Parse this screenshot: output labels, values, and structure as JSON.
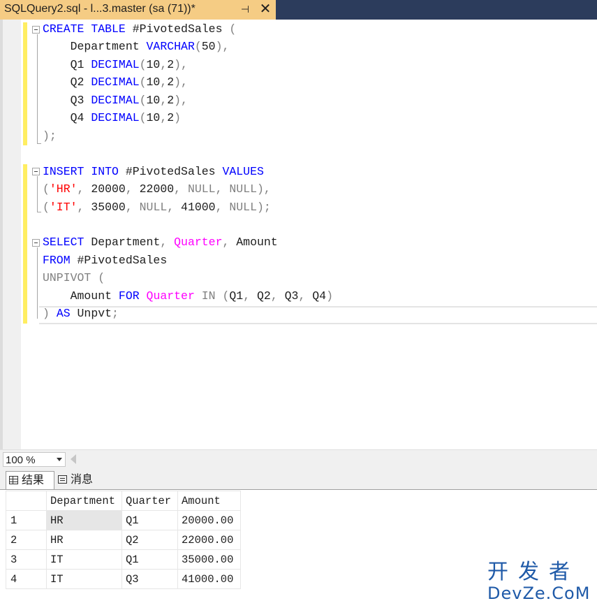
{
  "tab": {
    "title": "SQLQuery2.sql - l...3.master (sa (71))*",
    "pin_glyph": "⊣",
    "close_glyph": "✕"
  },
  "editor": {
    "lines": [
      [
        [
          "kw",
          "CREATE"
        ],
        [
          "tx",
          " "
        ],
        [
          "kw",
          "TABLE"
        ],
        [
          "tx",
          " #PivotedSales "
        ],
        [
          "gr",
          "("
        ]
      ],
      [
        [
          "tx",
          "    Department "
        ],
        [
          "kw",
          "VARCHAR"
        ],
        [
          "gr",
          "("
        ],
        [
          "tx",
          "50"
        ],
        [
          "gr",
          "),"
        ]
      ],
      [
        [
          "tx",
          "    Q1 "
        ],
        [
          "kw",
          "DECIMAL"
        ],
        [
          "gr",
          "("
        ],
        [
          "tx",
          "10"
        ],
        [
          "gr",
          ","
        ],
        [
          "tx",
          "2"
        ],
        [
          "gr",
          "),"
        ]
      ],
      [
        [
          "tx",
          "    Q2 "
        ],
        [
          "kw",
          "DECIMAL"
        ],
        [
          "gr",
          "("
        ],
        [
          "tx",
          "10"
        ],
        [
          "gr",
          ","
        ],
        [
          "tx",
          "2"
        ],
        [
          "gr",
          "),"
        ]
      ],
      [
        [
          "tx",
          "    Q3 "
        ],
        [
          "kw",
          "DECIMAL"
        ],
        [
          "gr",
          "("
        ],
        [
          "tx",
          "10"
        ],
        [
          "gr",
          ","
        ],
        [
          "tx",
          "2"
        ],
        [
          "gr",
          "),"
        ]
      ],
      [
        [
          "tx",
          "    Q4 "
        ],
        [
          "kw",
          "DECIMAL"
        ],
        [
          "gr",
          "("
        ],
        [
          "tx",
          "10"
        ],
        [
          "gr",
          ","
        ],
        [
          "tx",
          "2"
        ],
        [
          "gr",
          ")"
        ]
      ],
      [
        [
          "gr",
          ");"
        ]
      ],
      [],
      [
        [
          "kw",
          "INSERT"
        ],
        [
          "tx",
          " "
        ],
        [
          "kw",
          "INTO"
        ],
        [
          "tx",
          " #PivotedSales "
        ],
        [
          "kw",
          "VALUES"
        ]
      ],
      [
        [
          "gr",
          "("
        ],
        [
          "str",
          "'HR'"
        ],
        [
          "gr",
          ","
        ],
        [
          "tx",
          " 20000"
        ],
        [
          "gr",
          ","
        ],
        [
          "tx",
          " 22000"
        ],
        [
          "gr",
          ", NULL, NULL),"
        ]
      ],
      [
        [
          "gr",
          "("
        ],
        [
          "str",
          "'IT'"
        ],
        [
          "gr",
          ","
        ],
        [
          "tx",
          " 35000"
        ],
        [
          "gr",
          ", NULL,"
        ],
        [
          "tx",
          " 41000"
        ],
        [
          "gr",
          ", NULL);"
        ]
      ],
      [],
      [
        [
          "kw",
          "SELECT"
        ],
        [
          "tx",
          " Department"
        ],
        [
          "gr",
          ","
        ],
        [
          "tx",
          " "
        ],
        [
          "fn",
          "Quarter"
        ],
        [
          "gr",
          ","
        ],
        [
          "tx",
          " Amount"
        ]
      ],
      [
        [
          "kw",
          "FROM"
        ],
        [
          "tx",
          " #PivotedSales"
        ]
      ],
      [
        [
          "gr",
          "UNPIVOT ("
        ]
      ],
      [
        [
          "tx",
          "    Amount "
        ],
        [
          "kw",
          "FOR"
        ],
        [
          "tx",
          " "
        ],
        [
          "fn",
          "Quarter"
        ],
        [
          "tx",
          " "
        ],
        [
          "gr",
          "IN"
        ],
        [
          "tx",
          " "
        ],
        [
          "gr",
          "("
        ],
        [
          "tx",
          "Q1"
        ],
        [
          "gr",
          ","
        ],
        [
          "tx",
          " Q2"
        ],
        [
          "gr",
          ","
        ],
        [
          "tx",
          " Q3"
        ],
        [
          "gr",
          ","
        ],
        [
          "tx",
          " Q4"
        ],
        [
          "gr",
          ")"
        ]
      ],
      [
        [
          "gr",
          ")"
        ],
        [
          "tx",
          " "
        ],
        [
          "kw",
          "AS"
        ],
        [
          "tx",
          " Unpvt"
        ],
        [
          "gr",
          ";"
        ]
      ]
    ]
  },
  "zoom": {
    "value": "100 %"
  },
  "results_tabs": {
    "results_label": "结果",
    "messages_label": "消息"
  },
  "results": {
    "columns": [
      "Department",
      "Quarter",
      "Amount"
    ],
    "rows": [
      {
        "num": "1",
        "department": "HR",
        "quarter": "Q1",
        "amount": "20000.00"
      },
      {
        "num": "2",
        "department": "HR",
        "quarter": "Q2",
        "amount": "22000.00"
      },
      {
        "num": "3",
        "department": "IT",
        "quarter": "Q1",
        "amount": "35000.00"
      },
      {
        "num": "4",
        "department": "IT",
        "quarter": "Q3",
        "amount": "41000.00"
      }
    ]
  },
  "watermark": {
    "top": "开发者",
    "bottom": "DevZe.CoM"
  }
}
